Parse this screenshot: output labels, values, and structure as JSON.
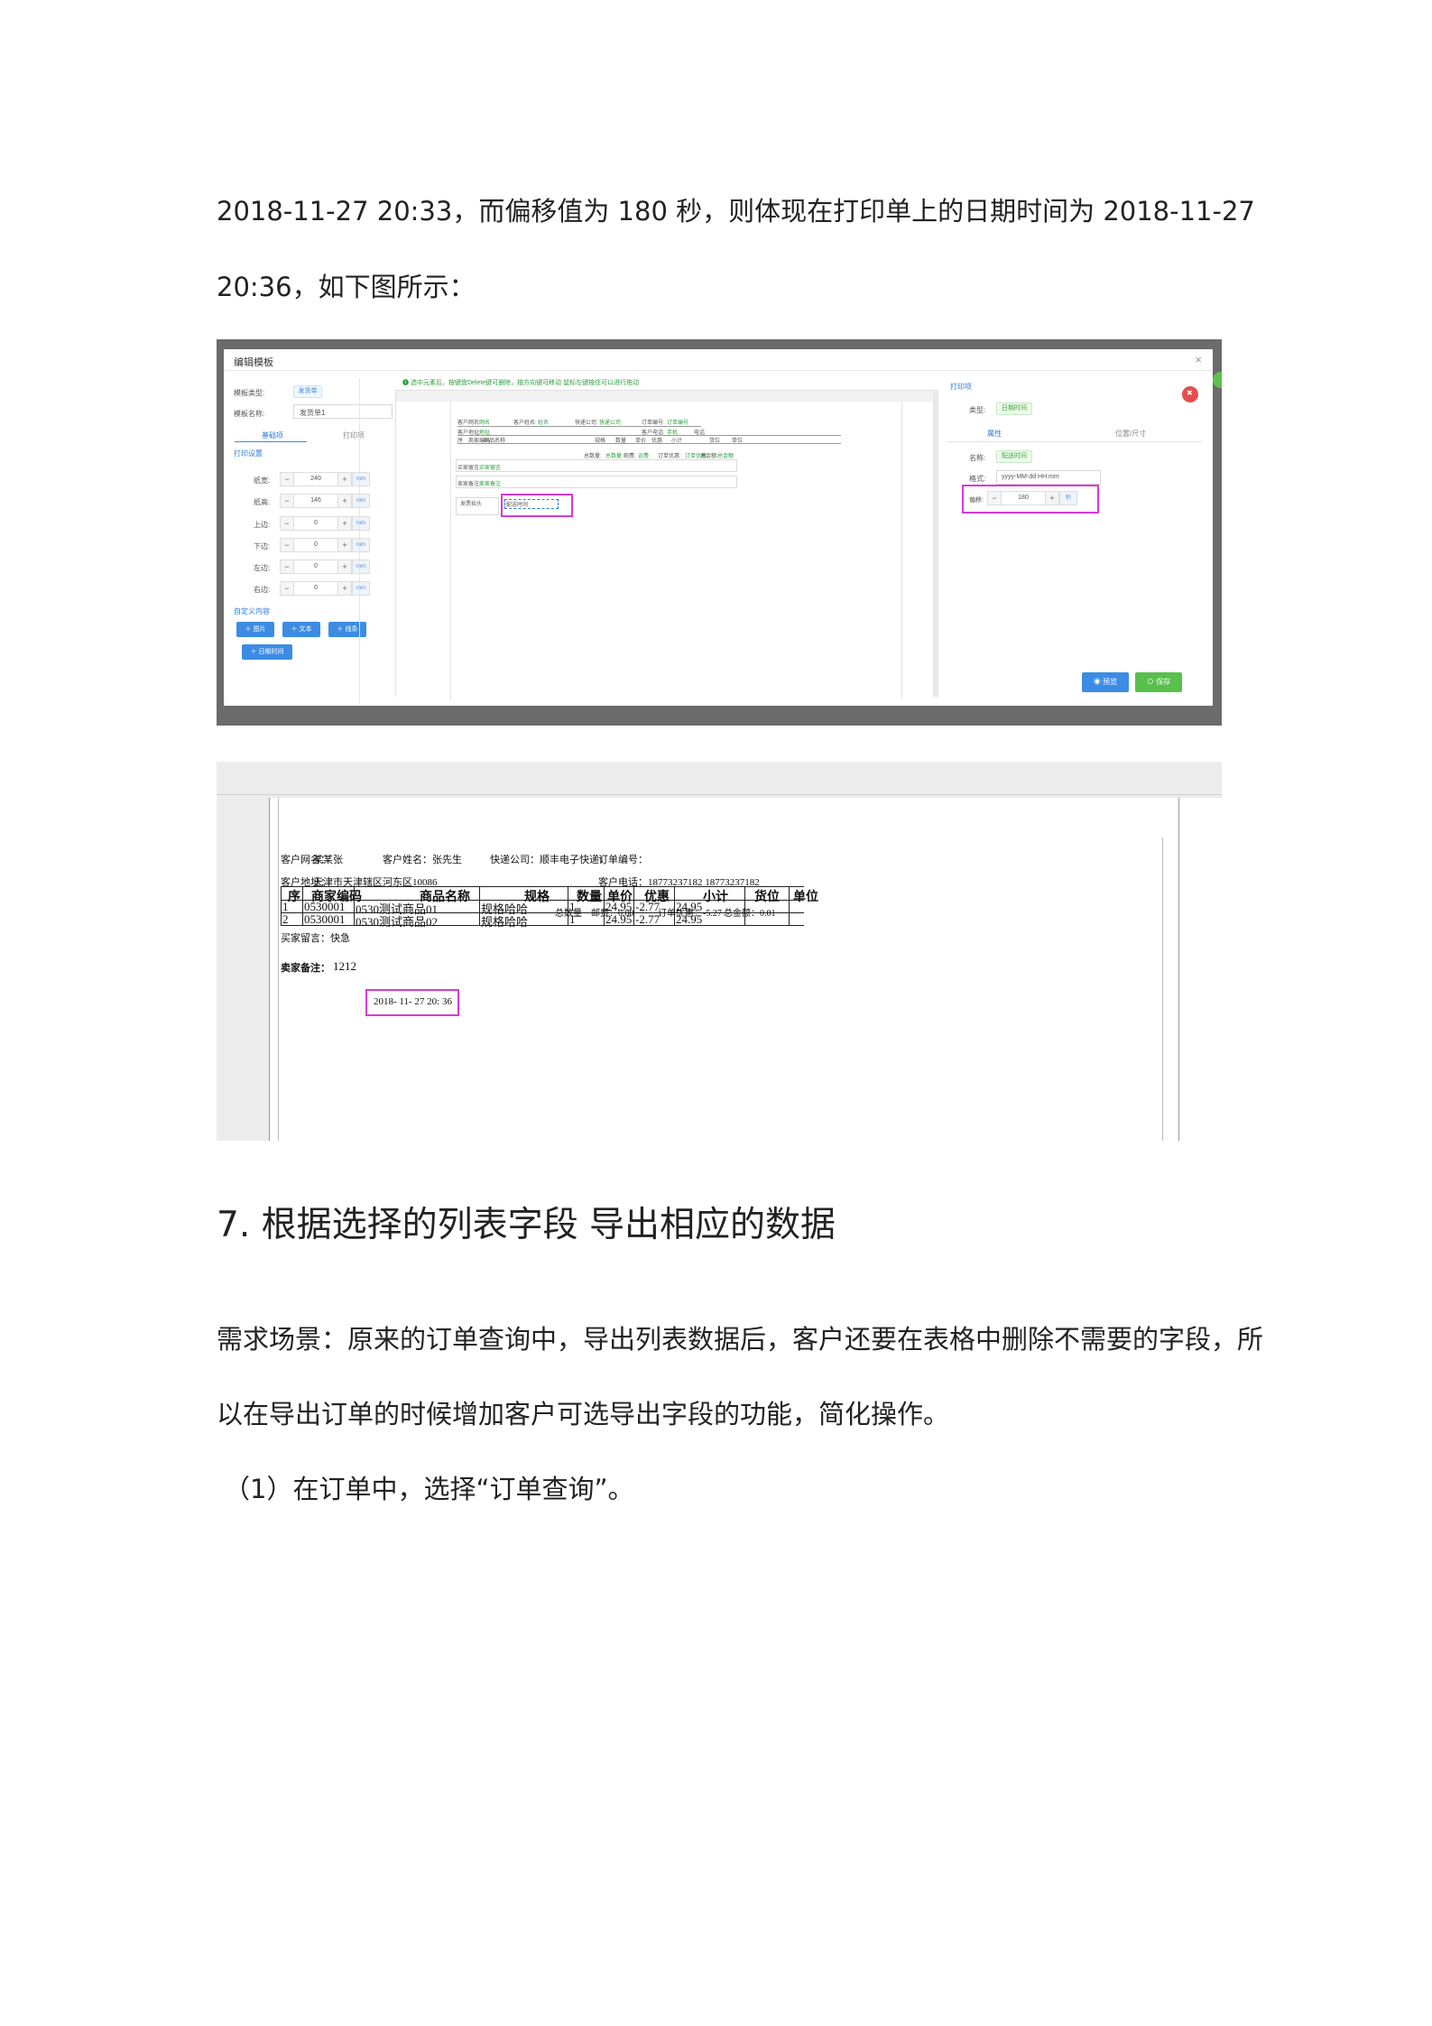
{
  "doc": {
    "line1": "2018-11-27 20:33，而偏移值为 180 秒，则体现在打印单上的日期时间为 2018-11-27",
    "line2": "20:36，如下图所示：",
    "heading": "7. 根据选择的列表字段  导出相应的数据",
    "line3": "需求场景：原来的订单查询中，导出列表数据后，客户还要在表格中删除不需要的字段，所",
    "line4": "以在导出订单的时候增加客户可选导出字段的功能，简化操作。",
    "line5": "（1）在订单中，选择“订单查询”。"
  },
  "editor": {
    "title": "编辑模板",
    "close": "×",
    "tip": "❶ 选中元素后，按键盘Delete键可删除，按方向键可移动 鼠标左键按住可以进行拖动",
    "template_type_label": "模板类型:",
    "template_type_value": "发货单",
    "template_name_label": "模板名称:",
    "template_name_value": "发货单1",
    "tab_basic": "基础项",
    "tab_print": "打印项",
    "print_settings": "打印设置",
    "fields": [
      {
        "label": "纸宽:",
        "value": "240",
        "unit": "mm"
      },
      {
        "label": "纸高:",
        "value": "146",
        "unit": "mm"
      },
      {
        "label": "上边:",
        "value": "0",
        "unit": "mm"
      },
      {
        "label": "下边:",
        "value": "0",
        "unit": "mm"
      },
      {
        "label": "左边:",
        "value": "0",
        "unit": "mm"
      },
      {
        "label": "右边:",
        "value": "0",
        "unit": "mm"
      }
    ],
    "custom_content": "自定义内容",
    "btn_image": "＋ 图片",
    "btn_text": "＋ 文本",
    "btn_line": "＋ 线条",
    "btn_datetime": "＋ 日期时间",
    "canvas": {
      "r1": [
        "客户网名:",
        "网名",
        "客户姓名:",
        "姓名",
        "快递公司:",
        "快递公司",
        "订单编号:",
        "订单编号"
      ],
      "r2": [
        "客户地址:",
        "地址",
        "客户电话:",
        "手机",
        "电话"
      ],
      "headers": [
        "序",
        "商家编码",
        "商品名称",
        "规格",
        "数量",
        "单价",
        "优惠",
        "小计",
        "货位",
        "单位"
      ],
      "totals": [
        "总数量:",
        "总数量",
        "邮费:",
        "运费",
        "订单优惠:",
        "订单优惠",
        "总金额:",
        "总金额"
      ],
      "buyer_msg_label": "买家留言:",
      "buyer_msg_value": "买家留言",
      "seller_note_label": "卖家备注:",
      "seller_note_value": "卖家备注",
      "left_box": "发票抬头",
      "datetime_box": "配送时间"
    },
    "right": {
      "title": "打印项",
      "type_label": "类型:",
      "type_value": "日期时间",
      "tab_attr": "属性",
      "tab_pos": "位置/尺寸",
      "name_label": "名称:",
      "name_value": "配送时间",
      "format_label": "格式:",
      "format_value": "yyyy-MM-dd HH:mm",
      "offset_label": "偏移:",
      "offset_value": "180",
      "offset_unit": "秒",
      "btn_preview": "◉ 预览",
      "btn_save": "⊙ 保存"
    }
  },
  "preview": {
    "r1": [
      "客户网名：",
      "某某张",
      "客户姓名：张先生",
      "快递公司：顺丰电子快递1",
      "订单编号："
    ],
    "r2": [
      "客户地址：",
      "天津市天津辖区河东区10086",
      "客户电话：18773237182   18773237182"
    ],
    "headers": [
      "序",
      "商家编码",
      "商品名称",
      "规格",
      "数量",
      "单价",
      "优惠",
      "小计",
      "货位",
      "单位"
    ],
    "rows": [
      [
        "1",
        "0530001",
        "0530测试商品01",
        "规格哈哈",
        "1",
        "24.95",
        "-2.77",
        "24.95"
      ],
      [
        "2",
        "0530001",
        "0530测试商品02",
        "规格哈哈",
        "1",
        "24.95",
        "-2.77",
        "24.95"
      ]
    ],
    "overlap": [
      "总数量",
      "邮费：0.00",
      "订单优惠：-5.27",
      "总金额：0.01"
    ],
    "buyer_msg": "买家留言：快急",
    "seller_note_label": "卖家备注：",
    "seller_note_value": "1212",
    "datetime": "2018- 11- 27  20: 36"
  }
}
